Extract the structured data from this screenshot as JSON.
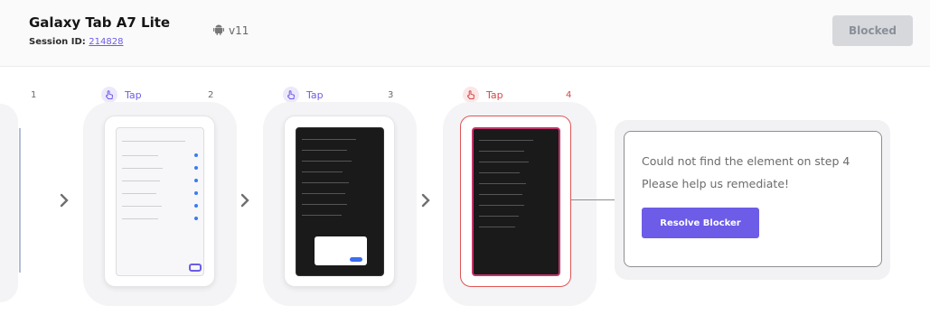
{
  "header": {
    "device_name": "Galaxy Tab A7 Lite",
    "session_label": "Session ID:",
    "session_id": "214828",
    "os_version": "v11",
    "status_button": "Blocked"
  },
  "steps": [
    {
      "number": "1"
    },
    {
      "number": "2",
      "action": "Tap"
    },
    {
      "number": "3",
      "action": "Tap"
    },
    {
      "number": "4",
      "action": "Tap",
      "status": "error"
    }
  ],
  "error_panel": {
    "message": "Could not find the element on step 4",
    "help": "Please help us remediate!",
    "resolve_button": "Resolve Blocker"
  },
  "colors": {
    "accent": "#6c5ce7",
    "error": "#d64545",
    "blocked_bg": "#d6d8dc"
  },
  "icons": {
    "android": "android-icon",
    "tap": "tap-hand-icon",
    "next": "chevron-right-icon"
  }
}
